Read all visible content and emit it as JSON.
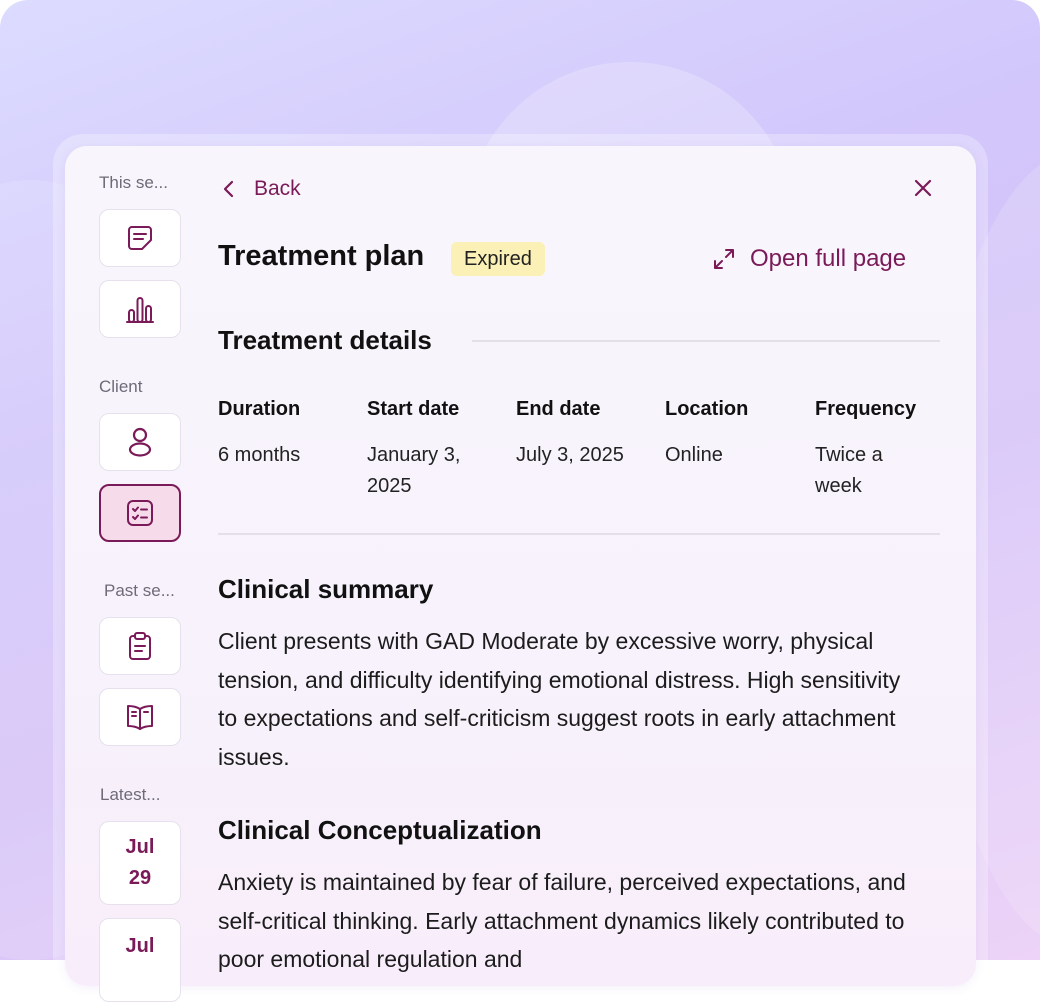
{
  "sidebar": {
    "this_session_label": "This se...",
    "client_label": "Client",
    "past_sessions_label": "Past se...",
    "latest_label": "Latest...",
    "latest_dates": [
      {
        "month": "Jul",
        "day": "29"
      },
      {
        "month": "Jul",
        "day": ""
      }
    ],
    "accent_color": "#7a1a58"
  },
  "header": {
    "back_label": "Back",
    "title": "Treatment plan",
    "status_badge": "Expired",
    "open_full_page_label": "Open full page"
  },
  "treatment_details": {
    "heading": "Treatment details",
    "columns": [
      {
        "label": "Duration",
        "value": "6 months"
      },
      {
        "label": "Start date",
        "value": "January 3, 2025"
      },
      {
        "label": "End date",
        "value": "July 3, 2025"
      },
      {
        "label": "Location",
        "value": "Online"
      },
      {
        "label": "Frequency",
        "value": "Twice a week"
      }
    ]
  },
  "clinical_summary": {
    "heading": "Clinical summary",
    "text": "Client presents with GAD Moderate by excessive worry, physical tension, and difficulty identifying emotional distress. High sensitivity to expectations and self-criticism suggest roots in early attachment issues."
  },
  "clinical_conceptualization": {
    "heading": "Clinical Conceptualization",
    "text": "Anxiety is maintained by fear of failure, perceived expectations, and self-critical thinking. Early attachment dynamics likely contributed to poor emotional regulation and"
  }
}
